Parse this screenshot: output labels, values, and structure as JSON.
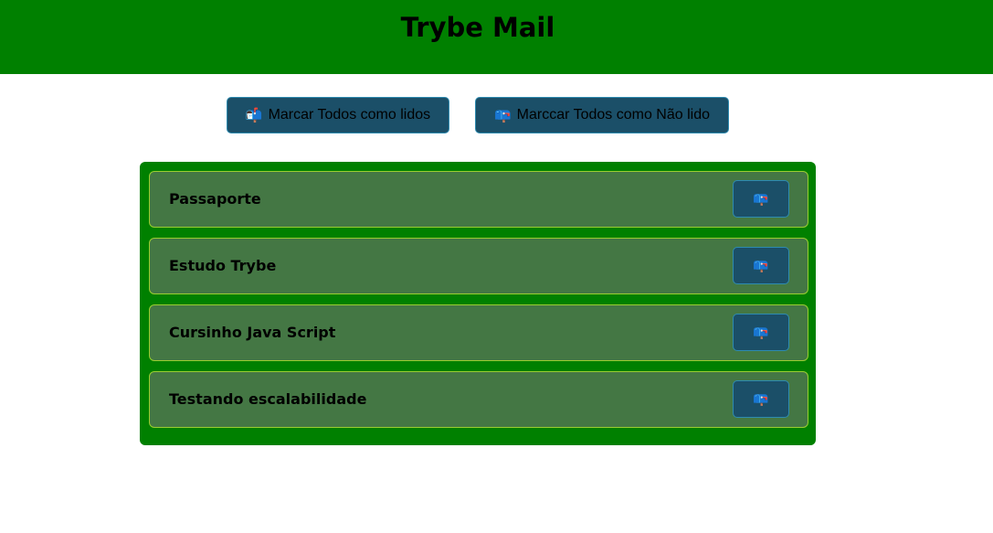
{
  "header": {
    "title": "Trybe Mail"
  },
  "actions": {
    "read_all": {
      "icon": "mailbox-with-mail-icon",
      "glyph": "📬",
      "label": "Marcar Todos como lidos"
    },
    "unread_all": {
      "icon": "mailbox-closed-icon",
      "glyph": "📪",
      "label": "Marccar Todos como Não lido"
    }
  },
  "emails": [
    {
      "title": "Passaporte",
      "status_icon": "mailbox-closed-icon",
      "glyph": "📪"
    },
    {
      "title": "Estudo Trybe",
      "status_icon": "mailbox-closed-icon",
      "glyph": "📪"
    },
    {
      "title": "Cursinho Java Script",
      "status_icon": "mailbox-closed-icon",
      "glyph": "📪"
    },
    {
      "title": "Testando escalabilidade",
      "status_icon": "mailbox-closed-icon",
      "glyph": "📪"
    }
  ],
  "colors": {
    "header_bg": "#008000",
    "list_bg": "#008000",
    "item_bg": "#447744",
    "item_border": "#9acd32",
    "button_bg": "#1b4f68",
    "button_border": "#2e8bb0"
  }
}
